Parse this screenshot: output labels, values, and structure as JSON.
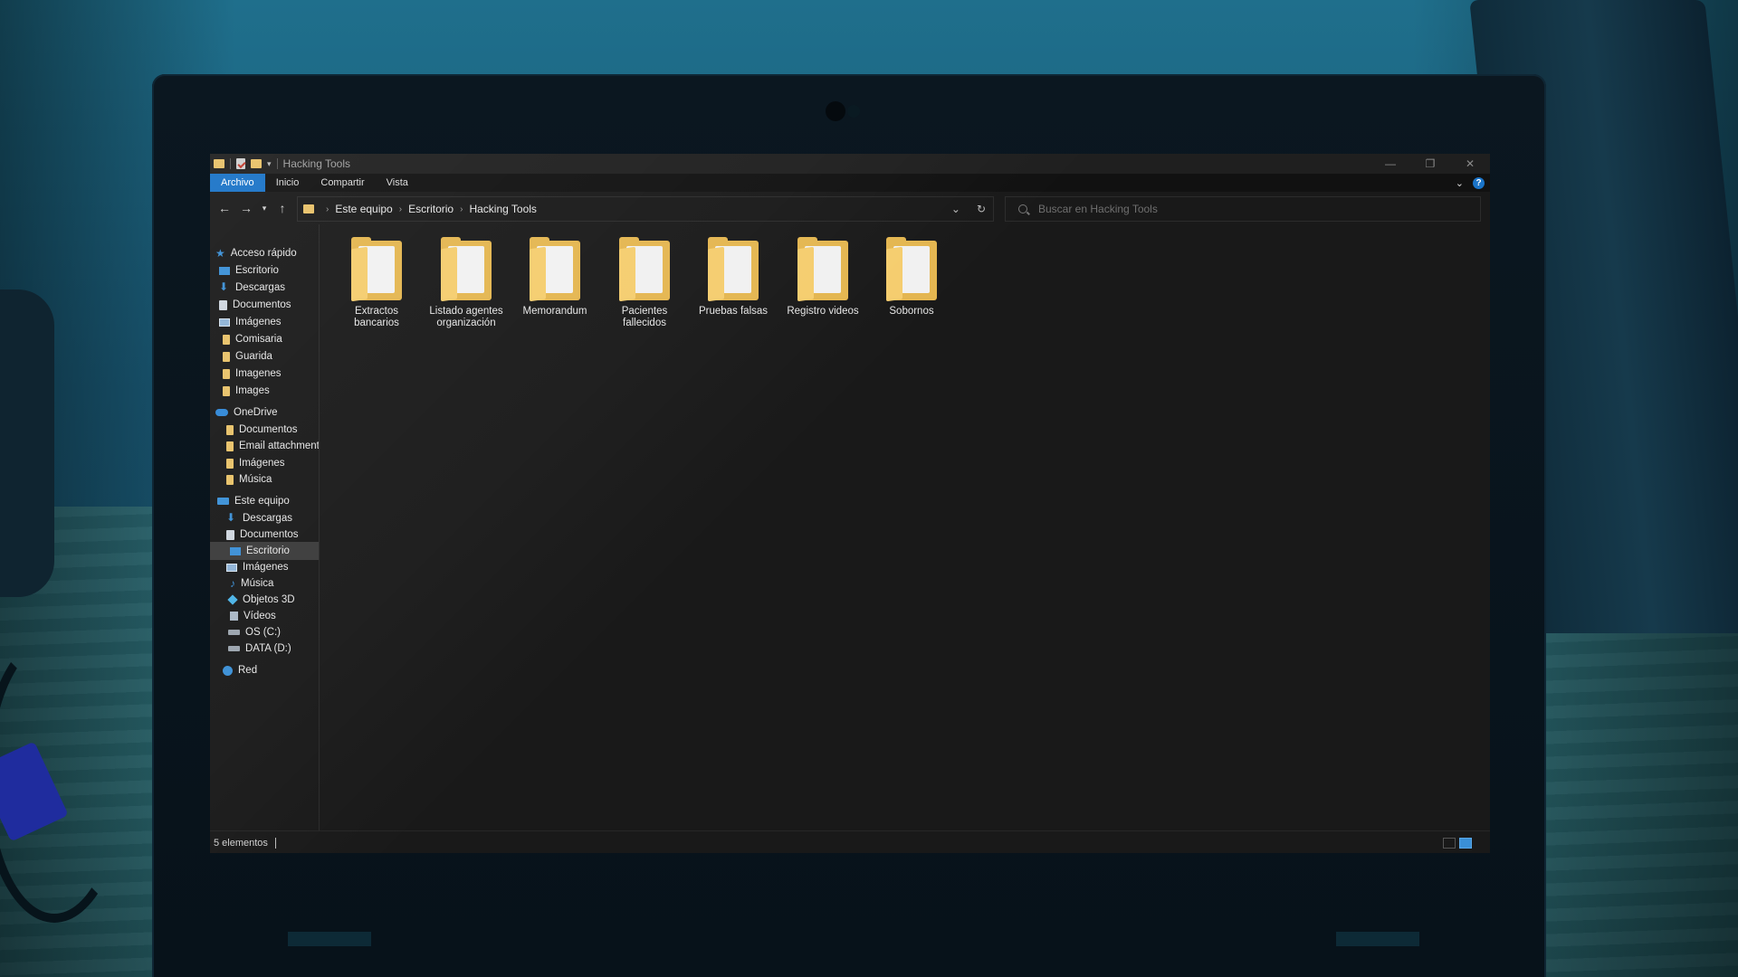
{
  "window": {
    "title": "Hacking Tools",
    "minimize_glyph": "—",
    "restore_glyph": "❐",
    "close_glyph": "✕"
  },
  "ribbon": {
    "tabs": [
      {
        "label": "Archivo",
        "active": true
      },
      {
        "label": "Inicio",
        "active": false
      },
      {
        "label": "Compartir",
        "active": false
      },
      {
        "label": "Vista",
        "active": false
      }
    ],
    "help": "?"
  },
  "address": {
    "breadcrumbs": [
      "Este equipo",
      "Escritorio",
      "Hacking Tools"
    ],
    "search_placeholder": "Buscar en Hacking Tools"
  },
  "nav": {
    "quick_access": {
      "label": "Acceso rápido",
      "items": [
        {
          "label": "Escritorio",
          "icon": "desktop-icon",
          "pinned": true
        },
        {
          "label": "Descargas",
          "icon": "download-icon",
          "pinned": true
        },
        {
          "label": "Documentos",
          "icon": "document-icon",
          "pinned": true
        },
        {
          "label": "Imágenes",
          "icon": "image-icon",
          "pinned": true
        },
        {
          "label": "Comisaria",
          "icon": "folder-icon",
          "pinned": false
        },
        {
          "label": "Guarida",
          "icon": "folder-icon",
          "pinned": false
        },
        {
          "label": "Imagenes",
          "icon": "folder-icon",
          "pinned": false
        },
        {
          "label": "Images",
          "icon": "folder-icon",
          "pinned": false
        }
      ]
    },
    "onedrive": {
      "label": "OneDrive",
      "items": [
        {
          "label": "Documentos",
          "icon": "folder-icon"
        },
        {
          "label": "Email attachments",
          "icon": "folder-icon"
        },
        {
          "label": "Imágenes",
          "icon": "folder-icon"
        },
        {
          "label": "Música",
          "icon": "folder-icon"
        }
      ]
    },
    "this_pc": {
      "label": "Este equipo",
      "items": [
        {
          "label": "Descargas",
          "icon": "download-icon"
        },
        {
          "label": "Documentos",
          "icon": "document-icon"
        },
        {
          "label": "Escritorio",
          "icon": "desktop-icon",
          "selected": true
        },
        {
          "label": "Imágenes",
          "icon": "image-icon"
        },
        {
          "label": "Música",
          "icon": "music-icon"
        },
        {
          "label": "Objetos 3D",
          "icon": "3d-objects-icon"
        },
        {
          "label": "Vídeos",
          "icon": "video-icon"
        },
        {
          "label": "OS (C:)",
          "icon": "drive-icon"
        },
        {
          "label": "DATA (D:)",
          "icon": "drive-icon"
        }
      ]
    },
    "network": {
      "label": "Red"
    }
  },
  "content": {
    "folders": [
      {
        "line1": "Extractos",
        "line2": "bancarios"
      },
      {
        "line1": "Listado agentes",
        "line2": "organización"
      },
      {
        "line1": "Memorandum",
        "line2": ""
      },
      {
        "line1": "Pacientes",
        "line2": "fallecidos"
      },
      {
        "line1": "Pruebas falsas",
        "line2": ""
      },
      {
        "line1": "Registro videos",
        "line2": ""
      },
      {
        "line1": "Sobornos",
        "line2": ""
      }
    ]
  },
  "status": {
    "items_text": "5 elementos"
  },
  "colors": {
    "accent": "#1a73c7",
    "window_bg": "#191919",
    "folder": "#e4b650"
  }
}
